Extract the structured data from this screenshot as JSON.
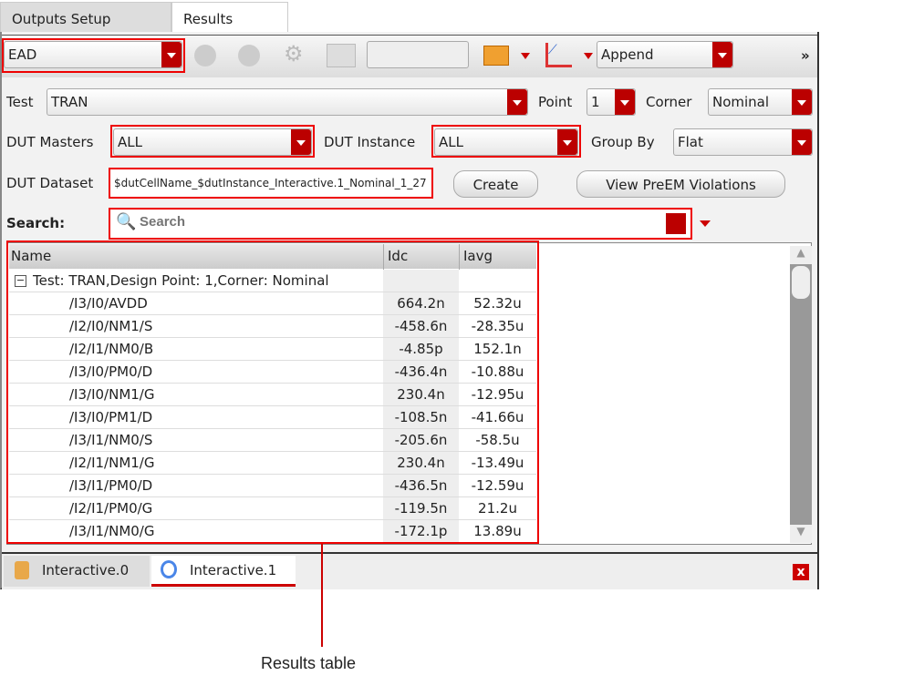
{
  "tabs": {
    "outputs_setup": "Outputs Setup",
    "results": "Results"
  },
  "toolbar": {
    "view": "EAD",
    "mode": "Append",
    "more": "»"
  },
  "filters": {
    "test_label": "Test",
    "test_value": "TRAN",
    "point_label": "Point",
    "point_value": "1",
    "corner_label": "Corner",
    "corner_value": "Nominal",
    "dut_masters_label": "DUT Masters",
    "dut_masters_value": "ALL",
    "dut_instance_label": "DUT Instance",
    "dut_instance_value": "ALL",
    "group_by_label": "Group By",
    "group_by_value": "Flat",
    "dut_dataset_label": "DUT Dataset",
    "dut_dataset_value": "$dutCellName_$dutInstance_Interactive.1_Nominal_1_27",
    "create": "Create",
    "view_preem": "View PreEM Violations",
    "search_label": "Search:",
    "search_placeholder": "Search"
  },
  "table": {
    "columns": [
      "Name",
      "Idc",
      "Iavg"
    ],
    "group": "Test: TRAN,Design Point: 1,Corner: Nominal",
    "rows": [
      {
        "name": "/I3/I0/AVDD",
        "idc": "664.2n",
        "iavg": "52.32u"
      },
      {
        "name": "/I2/I0/NM1/S",
        "idc": "-458.6n",
        "iavg": "-28.35u"
      },
      {
        "name": "/I2/I1/NM0/B",
        "idc": "-4.85p",
        "iavg": "152.1n"
      },
      {
        "name": "/I3/I0/PM0/D",
        "idc": "-436.4n",
        "iavg": "-10.88u"
      },
      {
        "name": "/I3/I0/NM1/G",
        "idc": "230.4n",
        "iavg": "-12.95u"
      },
      {
        "name": "/I3/I0/PM1/D",
        "idc": "-108.5n",
        "iavg": "-41.66u"
      },
      {
        "name": "/I3/I1/NM0/S",
        "idc": "-205.6n",
        "iavg": "-58.5u"
      },
      {
        "name": "/I2/I1/NM1/G",
        "idc": "230.4n",
        "iavg": "-13.49u"
      },
      {
        "name": "/I3/I1/PM0/D",
        "idc": "-436.5n",
        "iavg": "-12.59u"
      },
      {
        "name": "/I2/I1/PM0/G",
        "idc": "-119.5n",
        "iavg": "21.2u"
      },
      {
        "name": "/I3/I1/NM0/G",
        "idc": "-172.1p",
        "iavg": "13.89u"
      }
    ]
  },
  "bottom_tabs": [
    "Interactive.0",
    "Interactive.1"
  ],
  "callout": "Results table"
}
